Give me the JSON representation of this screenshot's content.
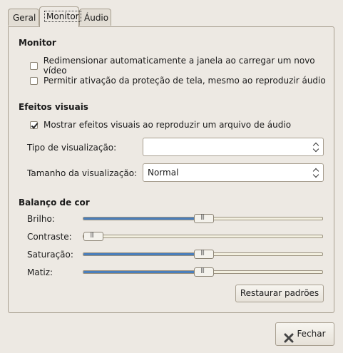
{
  "tabs": [
    {
      "label": "Geral",
      "active": false
    },
    {
      "label": "Monitor",
      "active": true
    },
    {
      "label": "Áudio",
      "active": false
    }
  ],
  "monitor": {
    "heading": "Monitor",
    "resize_label": "Redimensionar automaticamente a janela ao carregar um novo vídeo",
    "resize_checked": false,
    "screensaver_label": "Permitir ativação da proteção de tela, mesmo ao reproduzir áudio",
    "screensaver_checked": false
  },
  "visual": {
    "heading": "Efeitos visuais",
    "show_label": "Mostrar efeitos visuais ao reproduzir um arquivo de áudio",
    "show_checked": true,
    "type_label": "Tipo de visualização:",
    "type_value": "",
    "size_label": "Tamanho da visualização:",
    "size_value": "Normal"
  },
  "color": {
    "heading": "Balanço de cor",
    "sliders": [
      {
        "label": "Brilho:",
        "level": 0.5
      },
      {
        "label": "Contraste:",
        "level": 0.0
      },
      {
        "label": "Saturação:",
        "level": 0.5
      },
      {
        "label": "Matiz:",
        "level": 0.5
      }
    ],
    "reset_label": "Restaurar padrões"
  },
  "close_label": "Fechar",
  "colors": {
    "accent": "#4a7ebb",
    "background": "#ede9e3"
  }
}
